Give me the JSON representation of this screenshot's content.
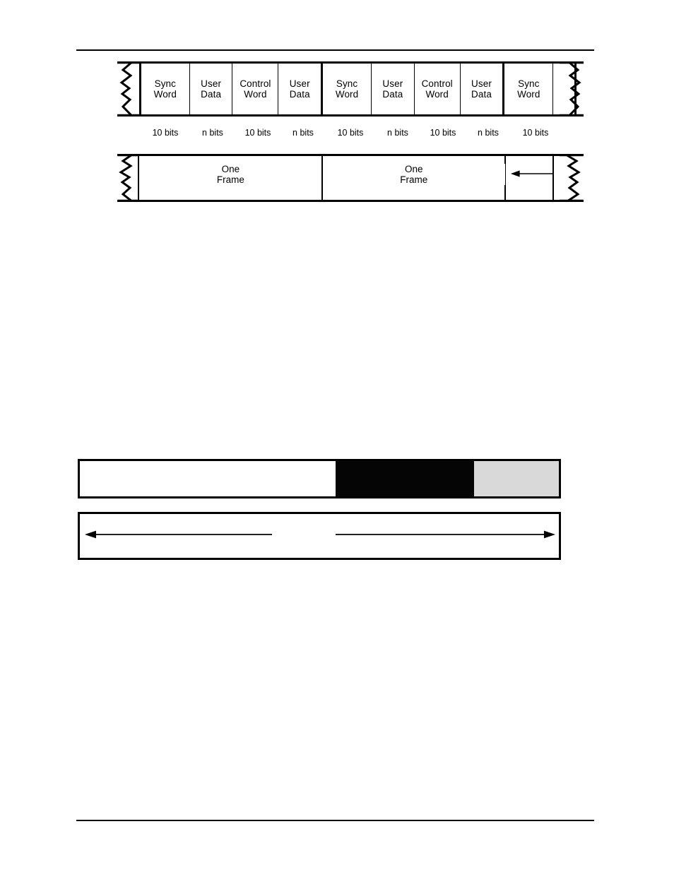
{
  "page": {
    "background_color": "#ffffff",
    "rule_color": "#000000"
  },
  "figure1": {
    "name": "frame-structure-diagram",
    "cells": [
      {
        "id": "sync-word-1",
        "line1": "Sync",
        "line2": "Word",
        "kind": "sync"
      },
      {
        "id": "user-data-1",
        "line1": "User",
        "line2": "Data",
        "kind": "udata"
      },
      {
        "id": "control-word-1",
        "line1": "Control",
        "line2": "Word",
        "kind": "ctrl"
      },
      {
        "id": "user-data-2",
        "line1": "User",
        "line2": "Data",
        "kind": "udata"
      },
      {
        "id": "sync-word-2",
        "line1": "Sync",
        "line2": "Word",
        "kind": "sync"
      },
      {
        "id": "user-data-3",
        "line1": "User",
        "line2": "Data",
        "kind": "udata"
      },
      {
        "id": "control-word-2",
        "line1": "Control",
        "line2": "Word",
        "kind": "ctrl"
      },
      {
        "id": "user-data-4",
        "line1": "User",
        "line2": "Data",
        "kind": "udata"
      },
      {
        "id": "sync-word-3",
        "line1": "Sync",
        "line2": "Word",
        "kind": "sync"
      }
    ],
    "bit_labels": [
      "10 bits",
      "n bits",
      "10 bits",
      "n bits",
      "10 bits",
      "n bits",
      "10 bits",
      "n bits",
      "10 bits"
    ],
    "frame_spans": [
      {
        "id": "frame-span-1",
        "line1": "One",
        "line2": "Frame",
        "arrows": "double"
      },
      {
        "id": "frame-span-2",
        "line1": "One",
        "line2": "Frame",
        "arrows": "double"
      },
      {
        "id": "frame-span-3",
        "line1": "",
        "line2": "",
        "arrows": "left"
      }
    ],
    "torn_edges": {
      "left": "zigzag-torn-edge",
      "right": "zigzag-torn-edge"
    }
  },
  "figure2": {
    "name": "shaded-bar-diagram",
    "segments": [
      {
        "id": "segment-white",
        "color": "#ffffff",
        "label": ""
      },
      {
        "id": "segment-black",
        "color": "#050505",
        "label": ""
      },
      {
        "id": "segment-gray",
        "color": "#d9d9d9",
        "label": ""
      }
    ],
    "span_arrows": [
      {
        "id": "span-arrow-left",
        "direction": "left",
        "label": ""
      },
      {
        "id": "span-arrow-right",
        "direction": "right",
        "label": ""
      }
    ]
  }
}
